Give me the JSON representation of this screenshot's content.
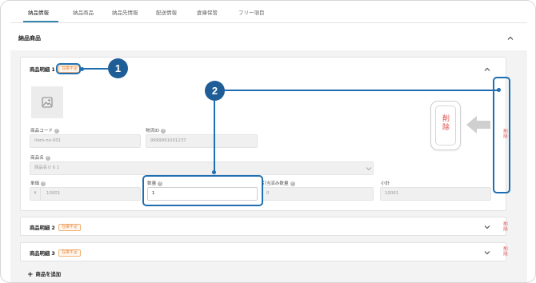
{
  "tabs": [
    {
      "label": "納品情報",
      "active": true
    },
    {
      "label": "納品商品",
      "active": false
    },
    {
      "label": "納品先情報",
      "active": false
    },
    {
      "label": "配送情報",
      "active": false
    },
    {
      "label": "倉庫保管",
      "active": false
    },
    {
      "label": "フリー項目",
      "active": false
    }
  ],
  "section": {
    "title": "納品商品"
  },
  "items": [
    {
      "title": "商品明細 1",
      "badge": "在庫不足",
      "delete_label": "削除",
      "fields": {
        "product_code": {
          "label": "商品コード",
          "value": "item-no-001"
        },
        "logistics_id": {
          "label": "物流ID",
          "value": "9999991001237"
        },
        "product_name": {
          "label": "商品名",
          "value": "商品名０６１"
        },
        "unit_price": {
          "label": "単価",
          "prefix": "¥",
          "value": "10001"
        },
        "quantity": {
          "label": "数量",
          "value": "1"
        },
        "allocated_qty": {
          "label": "引当済み数量",
          "value": "0"
        },
        "subtotal": {
          "label": "小計",
          "value": "10001"
        }
      }
    },
    {
      "title": "商品明細 2",
      "badge": "在庫不足",
      "delete_label": "削除"
    },
    {
      "title": "商品明細 3",
      "badge": "在庫不足",
      "delete_label": "削除"
    }
  ],
  "add_item_label": "商品を追加",
  "delete_illustration_label": "削除",
  "callouts": [
    "1",
    "2"
  ],
  "colors": {
    "accent": "#1f6fb0",
    "badge": "#e8883a",
    "delete": "#e05050"
  },
  "icons": [
    "chevron-up-icon",
    "chevron-down-icon",
    "image-placeholder-icon",
    "help-icon",
    "arrow-left-icon",
    "plus-icon"
  ]
}
